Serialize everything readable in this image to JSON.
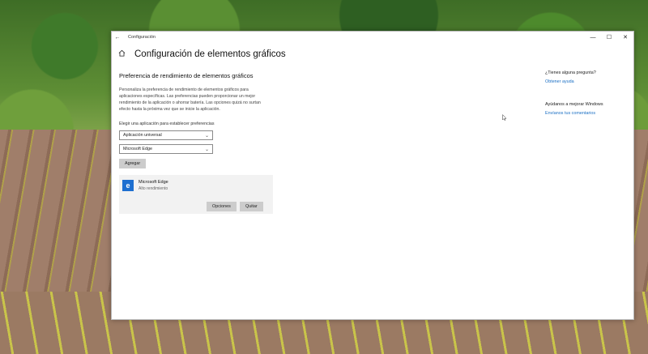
{
  "window": {
    "title": "Configuración",
    "back_glyph": "←",
    "controls": {
      "minimize": "—",
      "maximize": "☐",
      "close": "✕"
    }
  },
  "header": {
    "home_icon": "home-icon",
    "title": "Configuración de elementos gráficos"
  },
  "section": {
    "title": "Preferencia de rendimiento de elementos gráficos",
    "description": "Personaliza la preferencia de rendimiento de elementos gráficos para aplicaciones específicas. Las preferencias pueden proporcionar un mejor rendimiento de la aplicación o ahorrar batería. Las opciones quizá no surtan efecto hasta la próxima vez que se inicie la aplicación.",
    "choose_label": "Elegir una aplicación para establecer preferencias",
    "app_type_select": {
      "value": "Aplicación universal"
    },
    "app_select": {
      "value": "Microsoft Edge"
    },
    "add_button": "Agregar"
  },
  "app_entry": {
    "icon": "edge-icon",
    "icon_glyph": "e",
    "name": "Microsoft Edge",
    "status": "Alto rendimiento",
    "options_button": "Opciones",
    "remove_button": "Quitar"
  },
  "help": {
    "question": "¿Tienes alguna pregunta?",
    "get_help": "Obtener ayuda",
    "improve": "Ayúdanos a mejorar Windows",
    "feedback": "Envíanos tus comentarios"
  },
  "colors": {
    "accent": "#1a6fc4",
    "app_icon": "#1e6fd0",
    "button": "#cccccc"
  }
}
